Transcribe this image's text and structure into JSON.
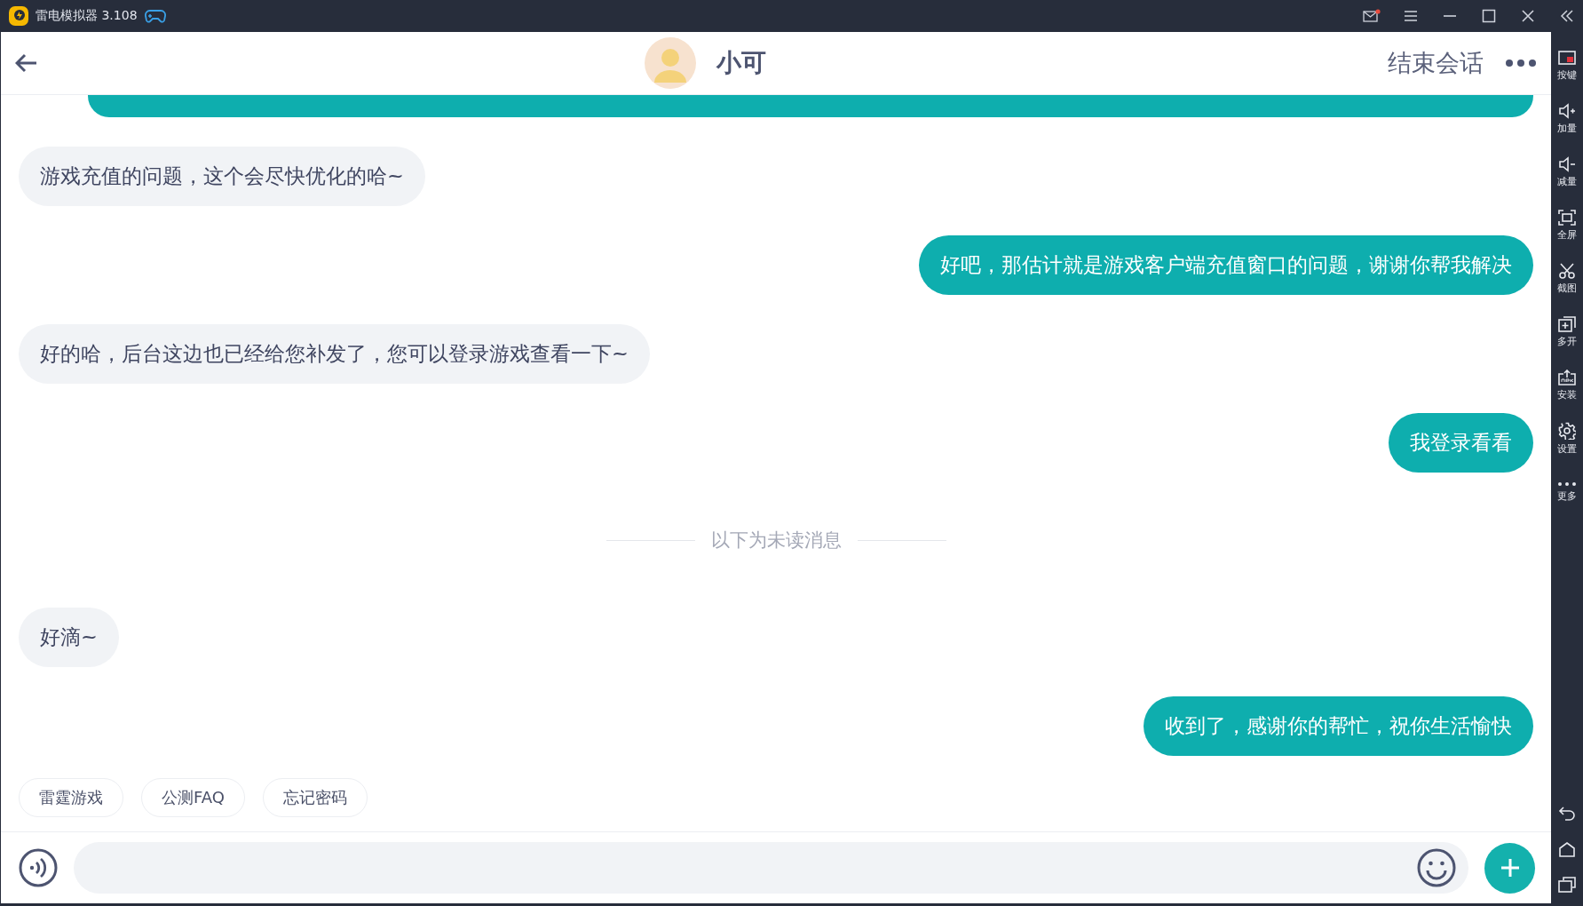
{
  "title_bar": {
    "app_name": "雷电模拟器",
    "version": "3.108"
  },
  "header": {
    "contact_name": "小可",
    "end_button": "结束会话"
  },
  "messages": [
    {
      "kind": "partial"
    },
    {
      "kind": "received",
      "text": "游戏充值的问题，这个会尽快优化的哈~"
    },
    {
      "kind": "sent",
      "text": "好吧，那估计就是游戏客户端充值窗口的问题，谢谢你帮我解决"
    },
    {
      "kind": "received",
      "text": "好的哈，后台这边也已经给您补发了，您可以登录游戏查看一下~"
    },
    {
      "kind": "sent",
      "text": "我登录看看"
    },
    {
      "kind": "divider",
      "text": "以下为未读消息"
    },
    {
      "kind": "received",
      "text": "好滴~"
    },
    {
      "kind": "sent",
      "text": "收到了，感谢你的帮忙，祝你生活愉快"
    }
  ],
  "quick_replies": [
    "雷霆游戏",
    "公测FAQ",
    "忘记密码"
  ],
  "sidebar": {
    "tools": [
      "按键",
      "加量",
      "减量",
      "全屏",
      "截图",
      "多开",
      "安装",
      "设置",
      "更多"
    ]
  }
}
